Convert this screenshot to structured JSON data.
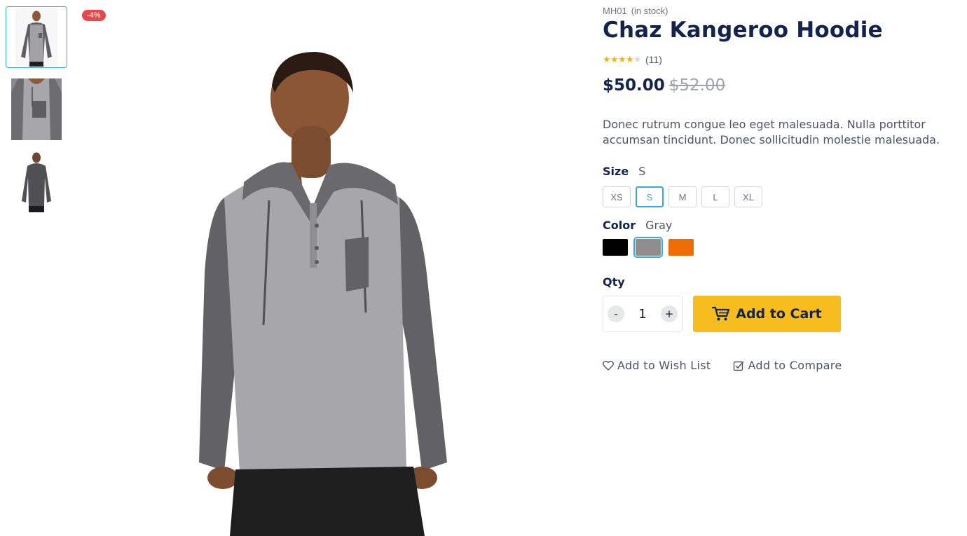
{
  "gallery": {
    "discount_badge": "-4%",
    "thumbnails": [
      "front",
      "closeup",
      "back"
    ]
  },
  "product": {
    "sku": "MH01",
    "stock_status": "(in stock)",
    "name": "Chaz Kangeroo Hoodie",
    "rating": {
      "stars": 4,
      "out_of": 5,
      "review_count": "(11)"
    },
    "price": "$50.00",
    "old_price": "$52.00",
    "description": "Donec rutrum congue leo eget malesuada. Nulla porttitor accumsan tincidunt. Donec sollicitudin molestie malesuada."
  },
  "size": {
    "label": "Size",
    "selected": "S",
    "options": [
      "XS",
      "S",
      "M",
      "L",
      "XL"
    ]
  },
  "color": {
    "label": "Color",
    "selected": "Gray",
    "options": [
      {
        "name": "Black",
        "hex": "#000000"
      },
      {
        "name": "Gray",
        "hex": "#8e8e8e"
      },
      {
        "name": "Orange",
        "hex": "#ef6c00"
      }
    ]
  },
  "qty": {
    "label": "Qty",
    "value": "1",
    "decrement": "-",
    "increment": "+"
  },
  "actions": {
    "add_to_cart": "Add to Cart",
    "add_to_wishlist": "Add to Wish List",
    "add_to_compare": "Add to Compare"
  },
  "colors": {
    "accent": "#38a8e0",
    "cta": "#f7bd1f",
    "heading": "#14234b",
    "badge": "#e5484d",
    "star": "#f5b60a"
  },
  "icons": [
    "cart-icon",
    "heart-icon",
    "compare-checkbox-icon",
    "star-icon"
  ]
}
